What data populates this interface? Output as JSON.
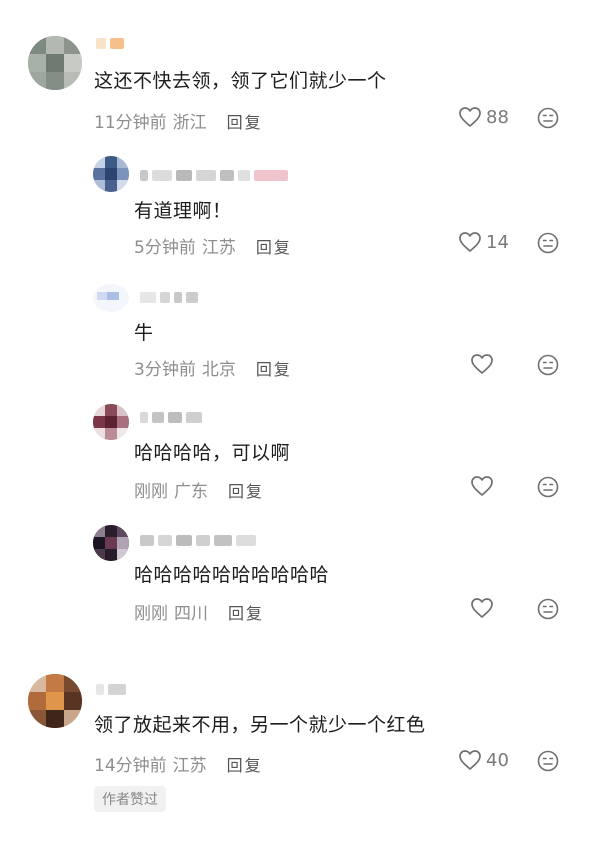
{
  "comments": [
    {
      "text": "这还不快去领，领了它们就少一个",
      "time": "11分钟前",
      "location": "浙江",
      "reply_label": "回复",
      "likes": "88",
      "replies": [
        {
          "text": "有道理啊！",
          "time": "5分钟前",
          "location": "江苏",
          "reply_label": "回复",
          "likes": "14"
        },
        {
          "text": "牛",
          "time": "3分钟前",
          "location": "北京",
          "reply_label": "回复",
          "likes": ""
        },
        {
          "text": "哈哈哈哈，可以啊",
          "time": "刚刚",
          "location": "广东",
          "reply_label": "回复",
          "likes": ""
        },
        {
          "text": "哈哈哈哈哈哈哈哈哈哈",
          "time": "刚刚",
          "location": "四川",
          "reply_label": "回复",
          "likes": ""
        }
      ]
    },
    {
      "text": "领了放起来不用，另一个就少一个红色",
      "time": "14分钟前",
      "location": "江苏",
      "reply_label": "回复",
      "likes": "40",
      "badge": "作者赞过"
    }
  ],
  "icons": {
    "like": "heart-outline-icon",
    "dislike": "neutral-face-icon"
  },
  "colors": {
    "text": "#1d1d1d",
    "meta": "#8e8e8e",
    "icon": "#6f6f6f",
    "badge_bg": "#f1f1f1"
  }
}
